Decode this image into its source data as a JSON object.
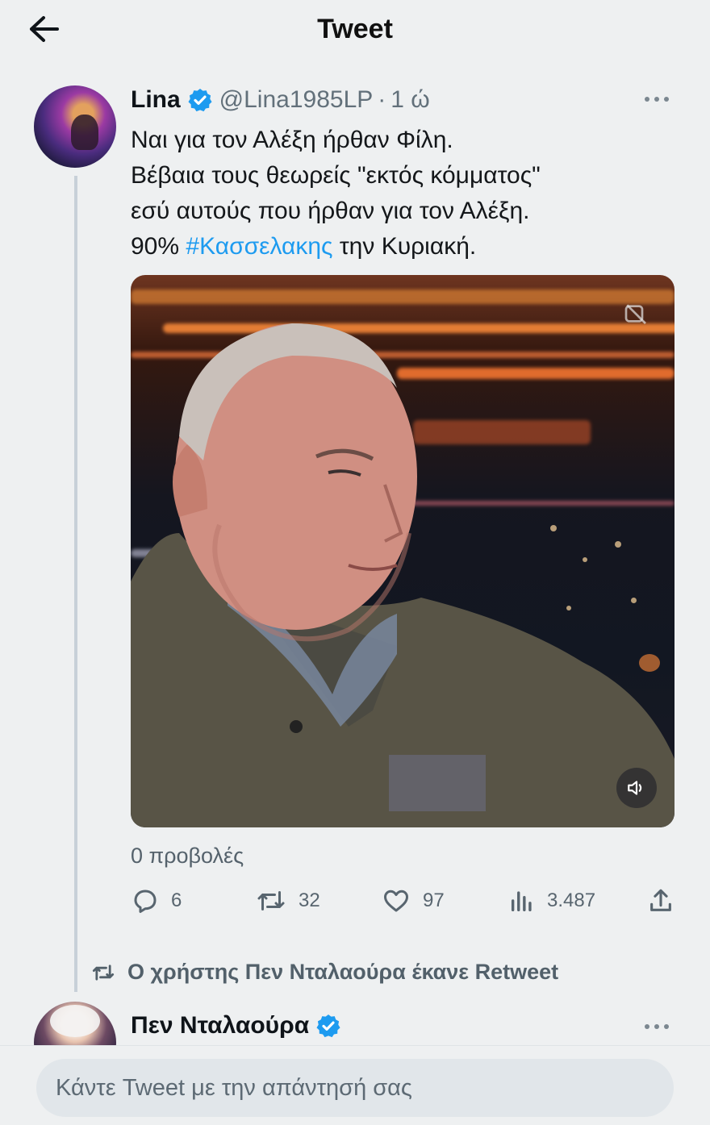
{
  "header": {
    "title": "Tweet",
    "back_icon": "arrow-left-icon"
  },
  "tweet": {
    "author_name": "Lina",
    "handle": "@Lina1985LP",
    "separator": "·",
    "time": "1 ώ",
    "text_lines": [
      "Ναι για τον Αλέξη ήρθαν Φίλη.",
      "Βέβαια τους θεωρείς \"εκτός κόμματος\"",
      "εσύ αυτούς που ήρθαν για τον Αλέξη."
    ],
    "last_line_before": "90% ",
    "hashtag": "#Κασσελακης",
    "last_line_after": " την Κυριακή.",
    "views": "0 προβολές",
    "stats": {
      "replies": "6",
      "retweets": "32",
      "likes": "97",
      "views": "3.487"
    }
  },
  "retweet_note": "Ο χρήστης Πεν Νταλαούρα έκανε Retweet",
  "next_tweet": {
    "author_name": "Πεν Νταλαούρα"
  },
  "reply": {
    "placeholder": "Κάντε Tweet με την απάντησή σας"
  },
  "colors": {
    "accent": "#1d9bf0",
    "background": "#eef0f1",
    "muted": "#62707a"
  }
}
